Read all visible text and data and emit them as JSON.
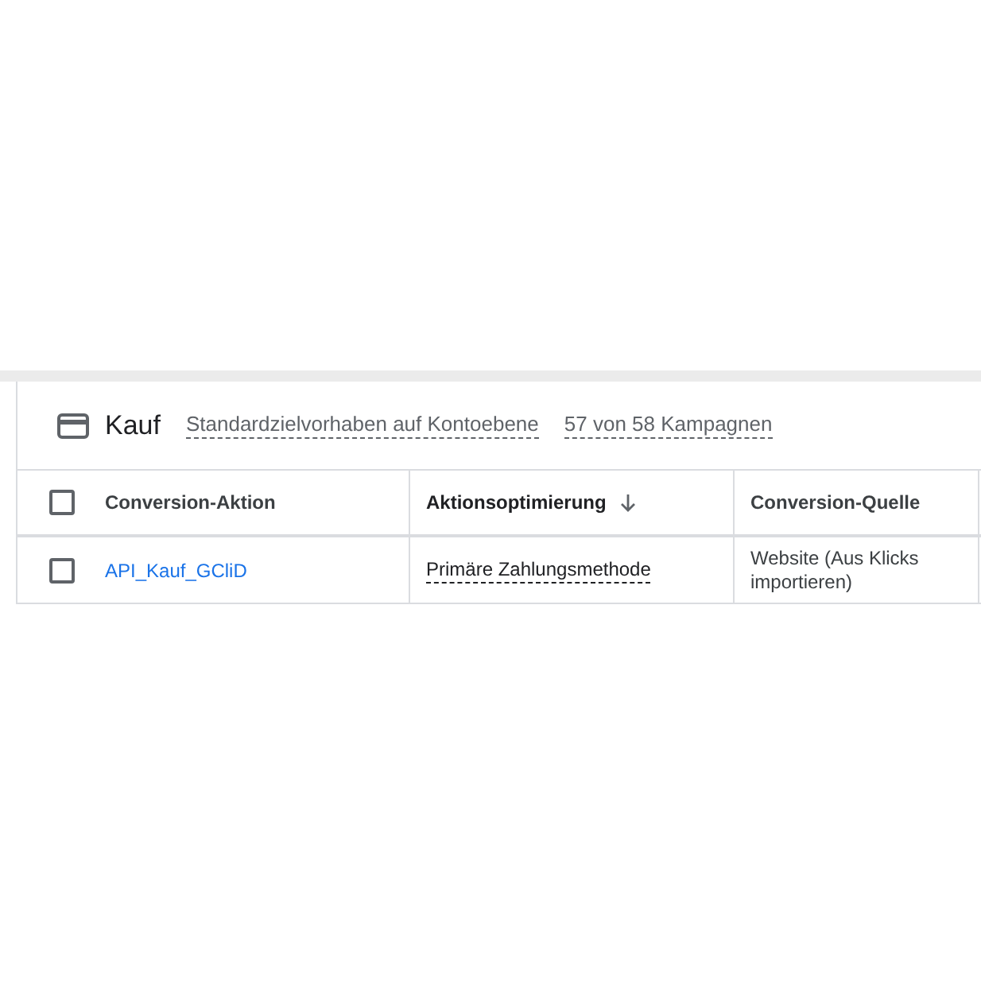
{
  "card": {
    "title": "Kauf",
    "goal_link": "Standardzielvorhaben auf Kontoebene",
    "campaigns_link": "57 von 58 Kampagnen"
  },
  "table": {
    "select_all": {
      "checked": false
    },
    "columns": [
      {
        "label": "Conversion-Aktion",
        "sorted": false
      },
      {
        "label": "Aktionsoptimierung",
        "sorted": true
      },
      {
        "label": "Conversion-Quelle",
        "sorted": false
      }
    ],
    "rows": [
      {
        "checked": false,
        "action": "API_Kauf_GCliD",
        "optimization": "Primäre Zahlungsmethode",
        "source": "Website (Aus Klicks importieren)"
      }
    ]
  }
}
